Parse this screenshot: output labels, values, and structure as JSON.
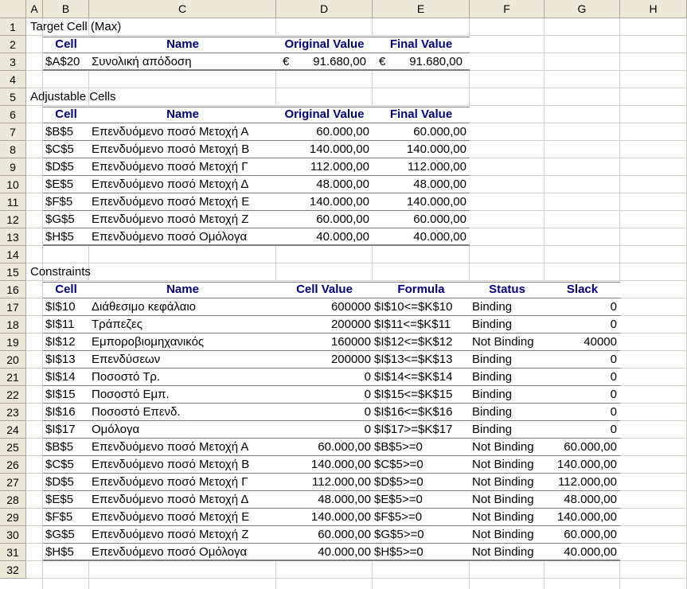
{
  "columns": [
    "A",
    "B",
    "C",
    "D",
    "E",
    "F",
    "G",
    "H"
  ],
  "rows": [
    "1",
    "2",
    "3",
    "4",
    "5",
    "6",
    "7",
    "8",
    "9",
    "10",
    "11",
    "12",
    "13",
    "14",
    "15",
    "16",
    "17",
    "18",
    "19",
    "20",
    "21",
    "22",
    "23",
    "24",
    "25",
    "26",
    "27",
    "28",
    "29",
    "30",
    "31",
    "32"
  ],
  "target": {
    "title": "Target Cell (Max)",
    "headers": {
      "cell": "Cell",
      "name": "Name",
      "original": "Original Value",
      "final": "Final Value"
    },
    "row": {
      "cell": "$A$20",
      "name": "Συνολική απόδοση",
      "cur1": "€",
      "original": "91.680,00",
      "cur2": "€",
      "final": "91.680,00"
    }
  },
  "adjustable": {
    "title": "Adjustable Cells",
    "headers": {
      "cell": "Cell",
      "name": "Name",
      "original": "Original Value",
      "final": "Final Value"
    },
    "rows": [
      {
        "cell": "$B$5",
        "name": "Επενδυόμενο ποσό Μετοχή Α",
        "original": "60.000,00",
        "final": "60.000,00"
      },
      {
        "cell": "$C$5",
        "name": "Επενδυόμενο ποσό Μετοχή Β",
        "original": "140.000,00",
        "final": "140.000,00"
      },
      {
        "cell": "$D$5",
        "name": "Επενδυόμενο ποσό Μετοχή Γ",
        "original": "112.000,00",
        "final": "112.000,00"
      },
      {
        "cell": "$E$5",
        "name": "Επενδυόμενο ποσό Μετοχή Δ",
        "original": "48.000,00",
        "final": "48.000,00"
      },
      {
        "cell": "$F$5",
        "name": "Επενδυόμενο ποσό Μετοχή Ε",
        "original": "140.000,00",
        "final": "140.000,00"
      },
      {
        "cell": "$G$5",
        "name": "Επενδυόμενο ποσό Μετοχή Ζ",
        "original": "60.000,00",
        "final": "60.000,00"
      },
      {
        "cell": "$H$5",
        "name": "Επενδυόμενο ποσό Ομόλογα",
        "original": "40.000,00",
        "final": "40.000,00"
      }
    ]
  },
  "constraints": {
    "title": "Constraints",
    "headers": {
      "cell": "Cell",
      "name": "Name",
      "value": "Cell Value",
      "formula": "Formula",
      "status": "Status",
      "slack": "Slack"
    },
    "rows": [
      {
        "cell": "$I$10",
        "name": "Διάθεσιμο κεφάλαιο",
        "value": "600000",
        "formula": "$I$10<=$K$10",
        "status": "Binding",
        "slack": "0"
      },
      {
        "cell": "$I$11",
        "name": "Τράπεζες",
        "value": "200000",
        "formula": "$I$11<=$K$11",
        "status": "Binding",
        "slack": "0"
      },
      {
        "cell": "$I$12",
        "name": "Εμποροβιομηχανικός",
        "value": "160000",
        "formula": "$I$12<=$K$12",
        "status": "Not Binding",
        "slack": "40000"
      },
      {
        "cell": "$I$13",
        "name": "Επενδύσεων",
        "value": "200000",
        "formula": "$I$13<=$K$13",
        "status": "Binding",
        "slack": "0"
      },
      {
        "cell": "$I$14",
        "name": "Ποσοστό Τρ.",
        "value": "0",
        "formula": "$I$14<=$K$14",
        "status": "Binding",
        "slack": "0"
      },
      {
        "cell": "$I$15",
        "name": "Ποσοστό Εμπ.",
        "value": "0",
        "formula": "$I$15<=$K$15",
        "status": "Binding",
        "slack": "0"
      },
      {
        "cell": "$I$16",
        "name": "Ποσοστό Επενδ.",
        "value": "0",
        "formula": "$I$16<=$K$16",
        "status": "Binding",
        "slack": "0"
      },
      {
        "cell": "$I$17",
        "name": "Ομόλογα",
        "value": "0",
        "formula": "$I$17>=$K$17",
        "status": "Binding",
        "slack": "0"
      },
      {
        "cell": "$B$5",
        "name": "Επενδυόμενο ποσό Μετοχή Α",
        "value": "60.000,00",
        "formula": "$B$5>=0",
        "status": "Not Binding",
        "slack": "60.000,00"
      },
      {
        "cell": "$C$5",
        "name": "Επενδυόμενο ποσό Μετοχή Β",
        "value": "140.000,00",
        "formula": "$C$5>=0",
        "status": "Not Binding",
        "slack": "140.000,00"
      },
      {
        "cell": "$D$5",
        "name": "Επενδυόμενο ποσό Μετοχή Γ",
        "value": "112.000,00",
        "formula": "$D$5>=0",
        "status": "Not Binding",
        "slack": "112.000,00"
      },
      {
        "cell": "$E$5",
        "name": "Επενδυόμενο ποσό Μετοχή Δ",
        "value": "48.000,00",
        "formula": "$E$5>=0",
        "status": "Not Binding",
        "slack": "48.000,00"
      },
      {
        "cell": "$F$5",
        "name": "Επενδυόμενο ποσό Μετοχή Ε",
        "value": "140.000,00",
        "formula": "$F$5>=0",
        "status": "Not Binding",
        "slack": "140.000,00"
      },
      {
        "cell": "$G$5",
        "name": "Επενδυόμενο ποσό Μετοχή Ζ",
        "value": "60.000,00",
        "formula": "$G$5>=0",
        "status": "Not Binding",
        "slack": "60.000,00"
      },
      {
        "cell": "$H$5",
        "name": "Επενδυόμενο ποσό Ομόλογα",
        "value": "40.000,00",
        "formula": "$H$5>=0",
        "status": "Not Binding",
        "slack": "40.000,00"
      }
    ]
  }
}
